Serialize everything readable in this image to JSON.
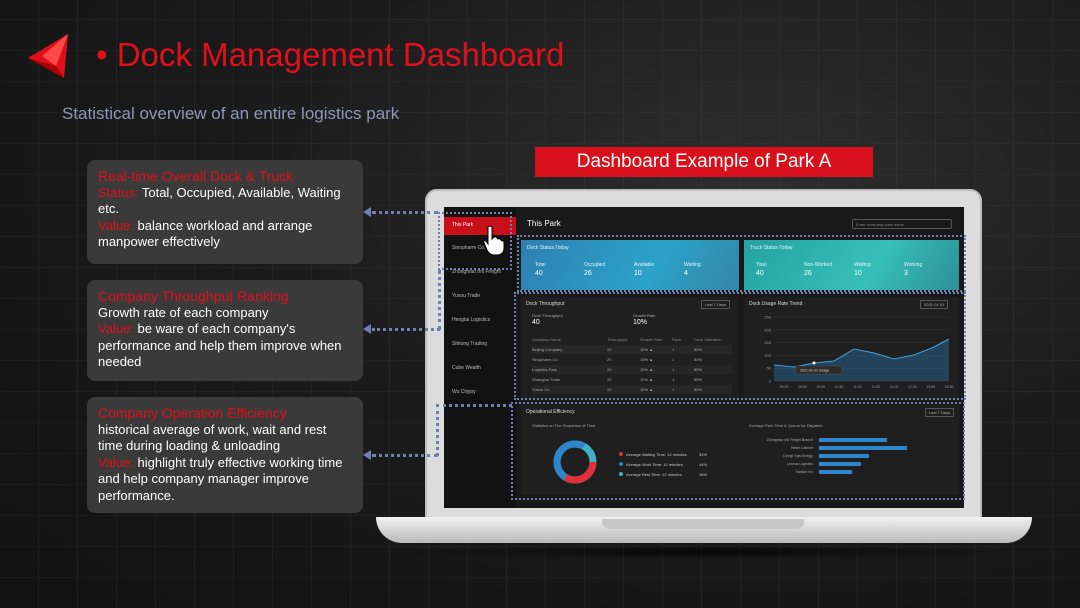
{
  "header": {
    "title": "• Dock Management Dashboard",
    "subtitle": "Statistical overview of an entire logistics park",
    "brand_color": "#e0101b"
  },
  "cards": [
    {
      "heading": "Real-time Overall Dock & Truck",
      "lead_label": "Status:",
      "lead_text": " Total, Occupied, Available, Waiting etc.",
      "value_label": "Value:",
      "value_text": " balance workload and arrange manpower effectively"
    },
    {
      "heading": "Company Throughput Ranking",
      "lead_label": "",
      "lead_text": "Growth rate of each company",
      "value_label": "Value:",
      "value_text": " be ware of each company's performance and help them improve when needed"
    },
    {
      "heading": "Company Operation Efficiency",
      "lead_label": "",
      "lead_text": "historical average of work, wait and rest time during loading & unloading",
      "value_label": "Value:",
      "value_text": " highlight truly effective working time and help company manager improve performance."
    }
  ],
  "banner": {
    "label": "Dashboard Example of Park A"
  },
  "screen": {
    "sidebar": [
      "This Park",
      "Sinopharm Co.",
      "Zhongmao Intl Freight",
      "Yusou Trade",
      "Hengtai Logistics",
      "Shitong Trading",
      "Cube Wealth",
      "Wu Cityjoy"
    ],
    "main_title": "This Park",
    "search_placeholder": "Enter company/ park name",
    "dock_status": {
      "title": "Dock Status Today",
      "labels": [
        "Total",
        "Occupied",
        "Available",
        "Waiting"
      ],
      "values": [
        "40",
        "26",
        "10",
        "4"
      ]
    },
    "truck_status": {
      "title": "Truck Status Today",
      "labels": [
        "Total",
        "Non-Worked",
        "Waiting",
        "Working"
      ],
      "values": [
        "40",
        "26",
        "10",
        "3"
      ]
    },
    "throughput": {
      "title": "Dock Throughput",
      "range": "Last 7 Days",
      "metric_left_label": "Dock Throughput",
      "metric_left_value": "40",
      "metric_right_label": "Growth Rate",
      "metric_right_value": "10%",
      "columns": [
        "Company Name",
        "Throughput",
        "Growth Rate",
        "Rank",
        "Dock Utilization"
      ],
      "rows": [
        [
          "Beijing Company",
          "20",
          "10% ▲",
          "1",
          "80%"
        ],
        [
          "Sinopharm Co.",
          "20",
          "10% ▲",
          "1",
          "80%"
        ],
        [
          "Logistics Park",
          "20",
          "10% ▲",
          "1",
          "80%"
        ],
        [
          "Shanghai Trade",
          "20",
          "10% ▲",
          "1",
          "80%"
        ],
        [
          "Yusou Co.",
          "20",
          "10% ▲",
          "1",
          "80%"
        ]
      ]
    },
    "usage_trend": {
      "title": "Dock Usage Rate Trend",
      "date": "2021-01-01",
      "tooltip": "2021-01-01 Usage",
      "y_ticks": [
        "250",
        "200",
        "150",
        "100",
        "50",
        "0"
      ],
      "x_ticks": [
        "09:00",
        "09:30",
        "10:00",
        "10:30",
        "11:00",
        "11:30",
        "12:00",
        "12:30",
        "13:00",
        "13:30"
      ]
    },
    "efficiency": {
      "title": "Operational Efficiency",
      "range": "Last 7 Days",
      "donut_title": "Statistics on The Proportion of Time",
      "legend": [
        {
          "label": "Average Waiting Time: 12 minutes",
          "value": "34%",
          "color": "#e0303b"
        },
        {
          "label": "Average Work Time: 12 minutes",
          "value": "44%",
          "color": "#2c86c9"
        },
        {
          "label": "Average Rest Time: 12 minutes",
          "value": "16%",
          "color": "#3fb0c8"
        }
      ],
      "bar_title": "Average Park Time & Queue for Dispatch",
      "bar_labels": [
        "Zhongmao Intl Freight Branch",
        "Hebei Cabinet",
        "Dongli Ygw Energy",
        "Uranus Logistics",
        "Tianlian Inc"
      ],
      "bar_values": [
        0.62,
        0.8,
        0.45,
        0.38,
        0.3
      ]
    }
  }
}
